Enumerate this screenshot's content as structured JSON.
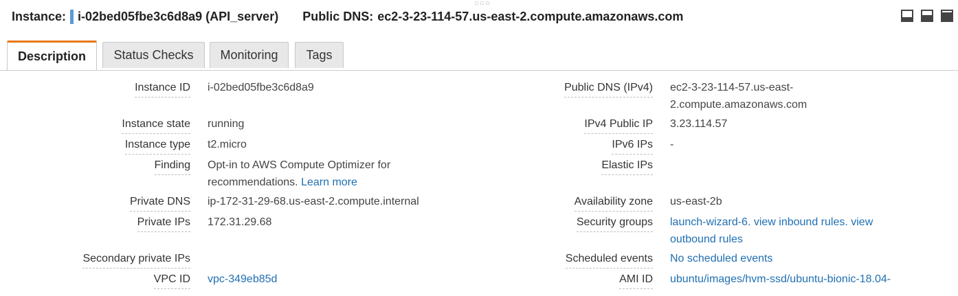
{
  "header": {
    "instance_label": "Instance:",
    "instance_id_name": "i-02bed05fbe3c6d8a9 (API_server)",
    "public_dns_label": "Public DNS:",
    "public_dns_value": "ec2-3-23-114-57.us-east-2.compute.amazonaws.com",
    "accent_color": "#5b9bd5",
    "drag_handle_icon": "drag-dots-icon",
    "window_buttons": [
      "panel-minimize-icon",
      "panel-half-icon",
      "panel-maximize-icon"
    ]
  },
  "tabs": [
    {
      "label": "Description",
      "active": true
    },
    {
      "label": "Status Checks",
      "active": false
    },
    {
      "label": "Monitoring",
      "active": false
    },
    {
      "label": "Tags",
      "active": false
    }
  ],
  "tab_accent_color": "#e47911",
  "details": {
    "left": {
      "instance_id": {
        "label": "Instance ID",
        "value": "i-02bed05fbe3c6d8a9"
      },
      "instance_state": {
        "label": "Instance state",
        "value": "running"
      },
      "instance_type": {
        "label": "Instance type",
        "value": "t2.micro"
      },
      "finding": {
        "label": "Finding",
        "value_line1": "Opt-in to AWS Compute Optimizer for",
        "value_line2": "recommendations.",
        "link": "Learn more"
      },
      "private_dns": {
        "label": "Private DNS",
        "value": "ip-172-31-29-68.us-east-2.compute.internal"
      },
      "private_ips": {
        "label": "Private IPs",
        "value": "172.31.29.68"
      },
      "secondary_private_ips": {
        "label": "Secondary private IPs",
        "value": ""
      },
      "vpc_id": {
        "label": "VPC ID",
        "value": "vpc-349eb85d"
      }
    },
    "right": {
      "public_dns_ipv4": {
        "label": "Public DNS (IPv4)",
        "value_line1": "ec2-3-23-114-57.us-east-",
        "value_line2": "2.compute.amazonaws.com"
      },
      "ipv4_public_ip": {
        "label": "IPv4 Public IP",
        "value": "3.23.114.57"
      },
      "ipv6_ips": {
        "label": "IPv6 IPs",
        "value": "-"
      },
      "elastic_ips": {
        "label": "Elastic IPs",
        "value": ""
      },
      "availability_zone": {
        "label": "Availability zone",
        "value": "us-east-2b"
      },
      "security_groups": {
        "label": "Security groups",
        "link1": "launch-wizard-6",
        "sep": ". ",
        "link2": "view inbound rules",
        "sep2": ". ",
        "link3_line1": "view",
        "link3_line2": "outbound rules"
      },
      "scheduled_events": {
        "label": "Scheduled events",
        "value": "No scheduled events"
      },
      "ami_id": {
        "label": "AMI ID",
        "value": "ubuntu/images/hvm-ssd/ubuntu-bionic-18.04-"
      }
    }
  }
}
